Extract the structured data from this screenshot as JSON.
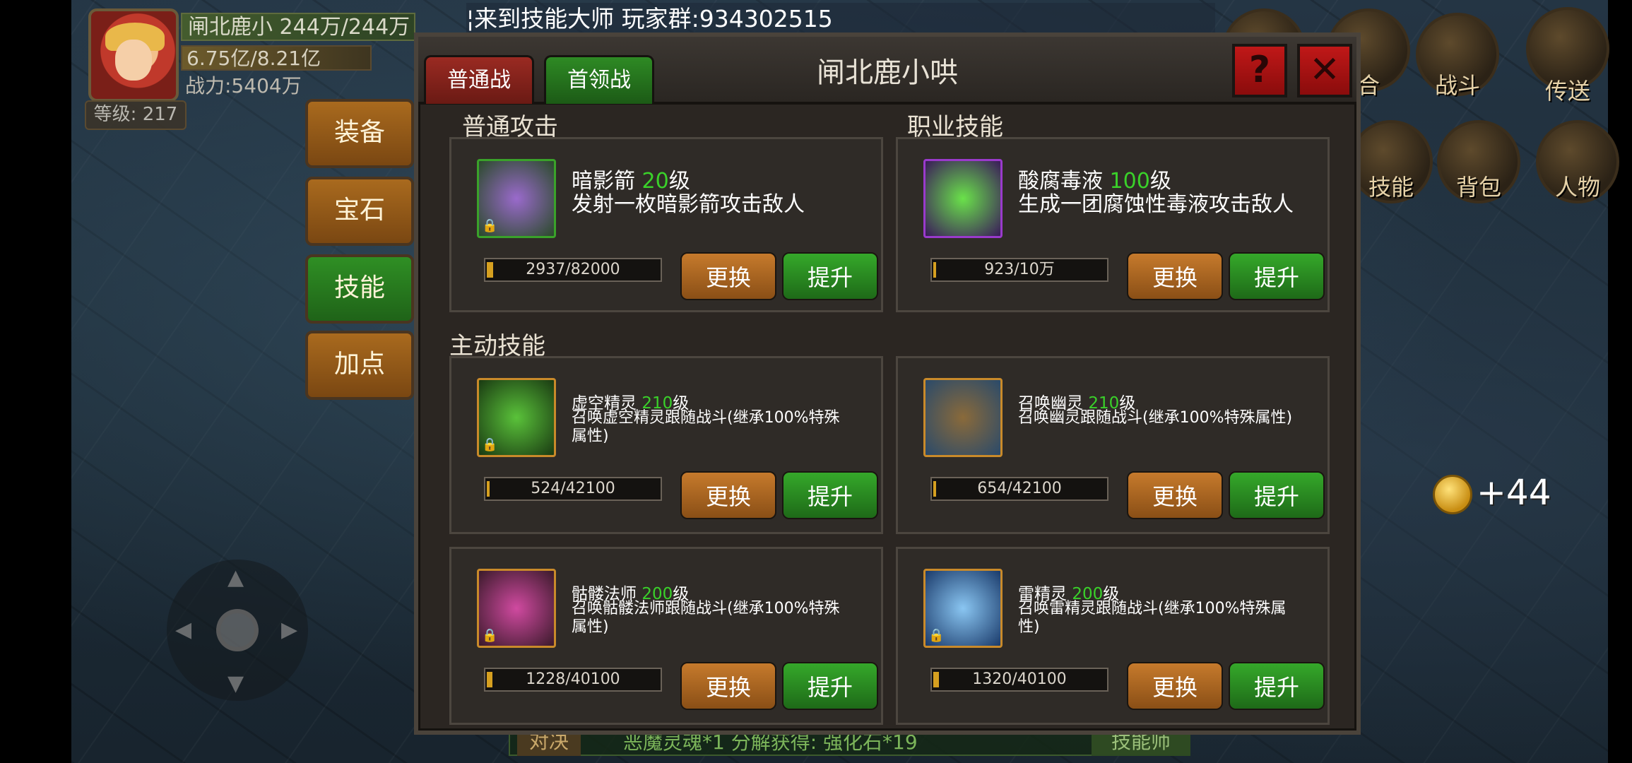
{
  "player": {
    "name_hp": "闸北鹿小 244万/244万",
    "exp": "6.75亿/8.21亿",
    "power": "战力:5404万",
    "level": "等级: 217"
  },
  "marquee": "¦来到技能大师 玩家群:934302515",
  "hud": {
    "labels": [
      "合",
      "战斗",
      "传送",
      "技能",
      "背包",
      "人物"
    ],
    "coin_text": "+44"
  },
  "side_tabs": [
    "装备",
    "宝石",
    "技能",
    "加点"
  ],
  "panel": {
    "title": "闸北鹿小哄",
    "tab_normal": "普通战",
    "tab_boss": "首领战",
    "help": "?",
    "close": "✕"
  },
  "sections": {
    "normal": "普通攻击",
    "class": "职业技能",
    "active": "主动技能"
  },
  "buttons": {
    "replace": "更换",
    "upgrade": "提升"
  },
  "skills": [
    {
      "name": "暗影箭",
      "level": "20",
      "suffix": "级",
      "desc": "发射一枚暗影箭攻击敌人",
      "progress": "2937/82000",
      "fill": 0.036,
      "color": "#4a8a3a"
    },
    {
      "name": "酸腐毒液",
      "level": "100",
      "suffix": "级",
      "desc": "生成一团腐蚀性毒液攻击敌人",
      "progress": "923/10万",
      "fill": 0.009,
      "color": "#6a2a8a"
    },
    {
      "name": "虚空精灵",
      "level": "210",
      "suffix": "级",
      "desc": "召唤虚空精灵跟随战斗(继承100%特殊属性)",
      "progress": "524/42100",
      "fill": 0.012,
      "color": "#2a7a2a"
    },
    {
      "name": "召唤幽灵",
      "level": "210",
      "suffix": "级",
      "desc": "召唤幽灵跟随战斗(继承100%特殊属性)",
      "progress": "654/42100",
      "fill": 0.016,
      "color": "#5a4a2a"
    },
    {
      "name": "骷髅法师",
      "level": "200",
      "suffix": "级",
      "desc": "召唤骷髅法师跟随战斗(继承100%特殊属性)",
      "progress": "1228/40100",
      "fill": 0.031,
      "color": "#6a2a5a"
    },
    {
      "name": "雷精灵",
      "level": "200",
      "suffix": "级",
      "desc": "召唤雷精灵跟随战斗(继承100%特殊属性)",
      "progress": "1320/40100",
      "fill": 0.033,
      "color": "#3a6a9a"
    }
  ],
  "bottom": {
    "left_btn": "对决",
    "message": "恶魔灵魂*1 分解获得: 强化石*19",
    "right_btn": "技能师"
  }
}
